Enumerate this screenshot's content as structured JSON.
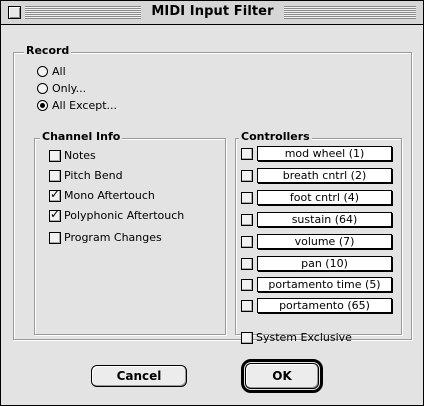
{
  "window": {
    "title": "MIDI Input Filter"
  },
  "record": {
    "label": "Record",
    "options": [
      {
        "label": "All",
        "selected": false
      },
      {
        "label": "Only...",
        "selected": false
      },
      {
        "label": "All Except...",
        "selected": true
      }
    ]
  },
  "channel_info": {
    "label": "Channel Info",
    "items": [
      {
        "label": "Notes",
        "checked": false
      },
      {
        "label": "Pitch Bend",
        "checked": false
      },
      {
        "label": "Mono Aftertouch",
        "checked": true
      },
      {
        "label": "Polyphonic Aftertouch",
        "checked": true
      },
      {
        "label": "Program Changes",
        "checked": false
      }
    ]
  },
  "controllers": {
    "label": "Controllers",
    "items": [
      {
        "value": "mod wheel (1)",
        "checked": false
      },
      {
        "value": "breath cntrl (2)",
        "checked": false
      },
      {
        "value": "foot cntrl (4)",
        "checked": false
      },
      {
        "value": "sustain (64)",
        "checked": false
      },
      {
        "value": "volume (7)",
        "checked": false
      },
      {
        "value": "pan (10)",
        "checked": false
      },
      {
        "value": "portamento time (5)",
        "checked": false
      },
      {
        "value": "portamento (65)",
        "checked": false
      }
    ]
  },
  "system_exclusive": {
    "label": "System Exclusive",
    "checked": false
  },
  "buttons": {
    "cancel": "Cancel",
    "ok": "OK"
  }
}
